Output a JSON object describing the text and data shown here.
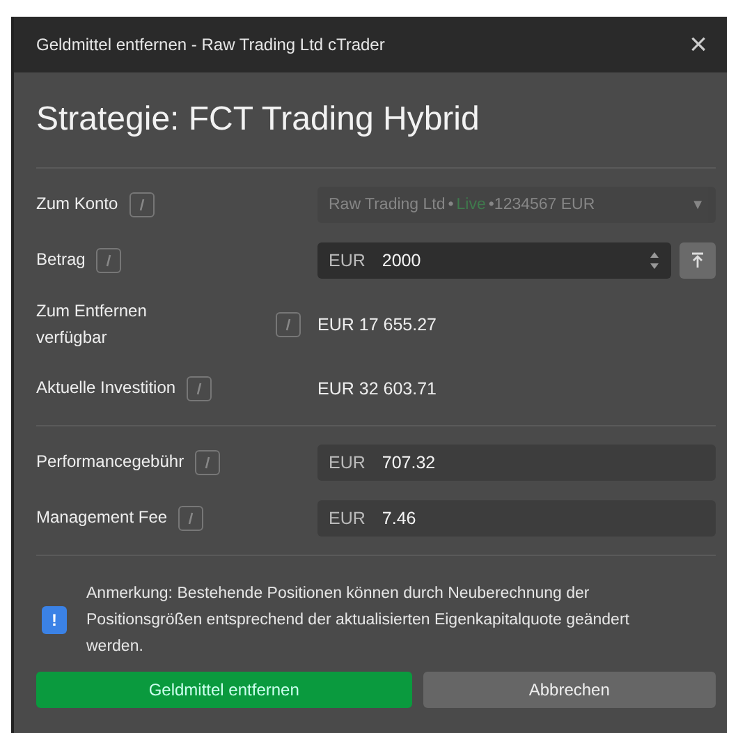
{
  "window": {
    "title": "Geldmittel entfernen - Raw Trading Ltd cTrader",
    "close": "×"
  },
  "heading": "Strategie: FCT Trading Hybrid",
  "rows": [
    {
      "kind": "select",
      "label": "Zum Konto",
      "disabled": true,
      "segments": [
        {
          "kind": "plain",
          "text": "Raw Trading Ltd"
        },
        {
          "kind": "plain",
          "text": "•"
        },
        {
          "kind": "live",
          "text": "Live"
        },
        {
          "kind": "plain",
          "text": "•1234567 EUR"
        }
      ],
      "caret": "▼"
    },
    {
      "kind": "stepper",
      "label": "Betrag",
      "currency": "EUR",
      "value": "2000"
    },
    {
      "kind": "value",
      "label": "Zum Entfernen verfügbar",
      "value": "EUR 17 655.27"
    },
    {
      "kind": "value",
      "label": "Aktuelle Investition",
      "value": "EUR 32 603.71"
    },
    {
      "kind": "divider"
    },
    {
      "kind": "fee",
      "label": "Performancegebühr",
      "currency": "EUR",
      "value": "707.32"
    },
    {
      "kind": "fee",
      "label": "Management Fee",
      "currency": "EUR",
      "value": "7.46"
    }
  ],
  "note": {
    "icon": "!",
    "text": "Anmerkung: Bestehende Positionen können durch Neuberechnung der Positionsgrößen entsprechend der aktualisierten Eigenkapitalquote geändert werden."
  },
  "buttons": [
    {
      "kind": "primary",
      "label": "Geldmittel entfernen"
    },
    {
      "kind": "secondary",
      "label": "Abbrechen"
    }
  ]
}
